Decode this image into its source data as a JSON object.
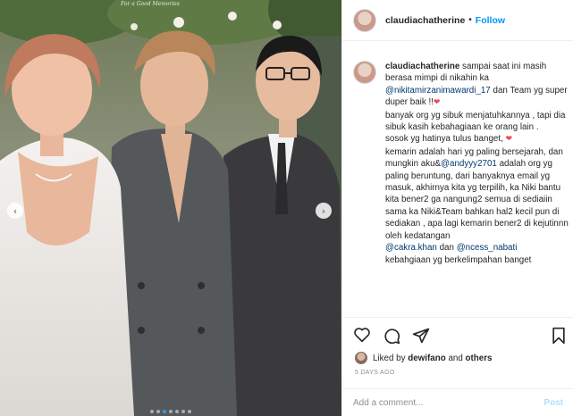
{
  "photo": {
    "watermark": "For a Good Memories",
    "nav_left_icon": "chevron-left-icon",
    "nav_right_icon": "chevron-right-icon",
    "carousel_dots": 7,
    "active_dot": 2
  },
  "header": {
    "username": "claudiachatherine",
    "separator": "•",
    "follow_label": "Follow"
  },
  "caption": {
    "username": "claudiachatherine",
    "lines": [
      "sampai saat ini masih berasa mimpi di nikahin ka",
      "@nikitamirzanimawardi_17",
      "dan Team yg super duper baik !!",
      "banyak org yg sibuk menjatuhkannya , tapi dia sibuk kasih kebahagiaan ke orang lain .",
      "sosok yg hatinya tulus banget,",
      "kemarin adalah hari yg paling bersejarah, dan mungkin aku&",
      "@andyyy2701",
      "adalah org yg paling beruntung, dari banyaknya email yg masuk, akhirnya kita yg terpilih, ka Niki bantu kita bener2 ga nangung2 semua di sediaiin sama ka Niki&Team bahkan hal2 kecil pun di sediakan , apa lagi kemarin bener2 di kejutinnn oleh kedatangan",
      "@cakra.khan",
      "dan",
      "@ncess_nabati",
      "kebahgiaan yg berkelimpahan banget"
    ],
    "heart_glyph": "❤"
  },
  "actions": {
    "like_icon": "heart-outline-icon",
    "comment_icon": "comment-icon",
    "share_icon": "share-icon",
    "save_icon": "bookmark-icon"
  },
  "likes": {
    "prefix": "Liked by",
    "user": "dewifano",
    "middle": "and",
    "others": "others"
  },
  "timestamp": "5 DAYS AGO",
  "comment_box": {
    "placeholder": "Add a comment...",
    "post_label": "Post"
  },
  "colors": {
    "link": "#00376b",
    "follow": "#0095f6",
    "post_disabled": "#b2dffc",
    "heart": "#ed4956"
  }
}
